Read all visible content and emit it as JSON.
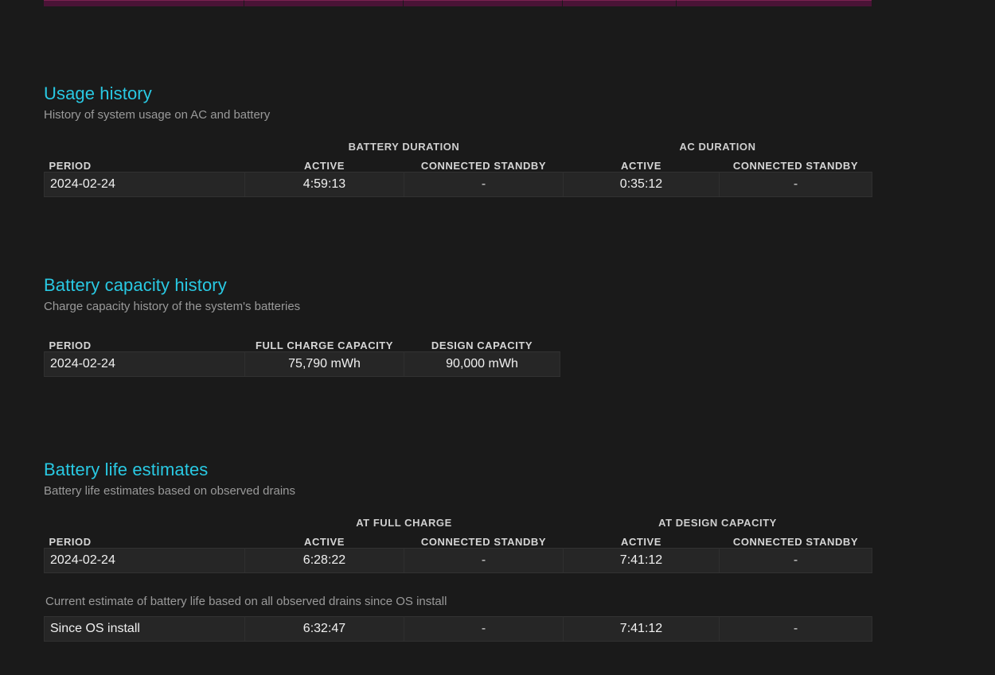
{
  "top_chart_strip": {
    "name": "battery-usage-bar-chart-cutoff",
    "bar_color": "#4a1336",
    "bar_highlight": "#7a2250",
    "segment_widths": [
      252,
      200,
      200,
      143,
      245
    ]
  },
  "sections": [
    {
      "id": "usage-history",
      "title": "Usage history",
      "subtitle": "History of system usage on AC and battery",
      "group_headers": [
        {
          "label": "",
          "span": 1
        },
        {
          "label": "BATTERY DURATION",
          "span": 2
        },
        {
          "label": "AC DURATION",
          "span": 2
        }
      ],
      "columns": [
        "PERIOD",
        "ACTIVE",
        "CONNECTED STANDBY",
        "ACTIVE",
        "CONNECTED STANDBY"
      ],
      "rows": [
        [
          "2024-02-24",
          "4:59:13",
          "-",
          "0:35:12",
          "-"
        ]
      ]
    },
    {
      "id": "battery-capacity-history",
      "title": "Battery capacity history",
      "subtitle": "Charge capacity history of the system's batteries",
      "group_headers": [],
      "columns": [
        "PERIOD",
        "FULL CHARGE CAPACITY",
        "DESIGN CAPACITY"
      ],
      "rows": [
        [
          "2024-02-24",
          "75,790 mWh",
          "90,000 mWh"
        ]
      ]
    },
    {
      "id": "battery-life-estimates",
      "title": "Battery life estimates",
      "subtitle": "Battery life estimates based on observed drains",
      "group_headers": [
        {
          "label": "",
          "span": 1
        },
        {
          "label": "AT FULL CHARGE",
          "span": 2
        },
        {
          "label": "AT DESIGN CAPACITY",
          "span": 2
        }
      ],
      "columns": [
        "PERIOD",
        "ACTIVE",
        "CONNECTED STANDBY",
        "ACTIVE",
        "CONNECTED STANDBY"
      ],
      "rows": [
        [
          "2024-02-24",
          "6:28:22",
          "-",
          "7:41:12",
          "-"
        ]
      ],
      "note": "Current estimate of battery life based on all observed drains since OS install",
      "note_rows": [
        [
          "Since OS install",
          "6:32:47",
          "-",
          "7:41:12",
          "-"
        ]
      ]
    }
  ],
  "colors": {
    "page_background": "#1a1a1a",
    "heading": "#29c9e3",
    "subtitle": "#9a9a9a",
    "row_background": "#262626",
    "row_border": "#323232",
    "value_text": "#f0f0f0",
    "column_header": "#d6d6d6"
  }
}
